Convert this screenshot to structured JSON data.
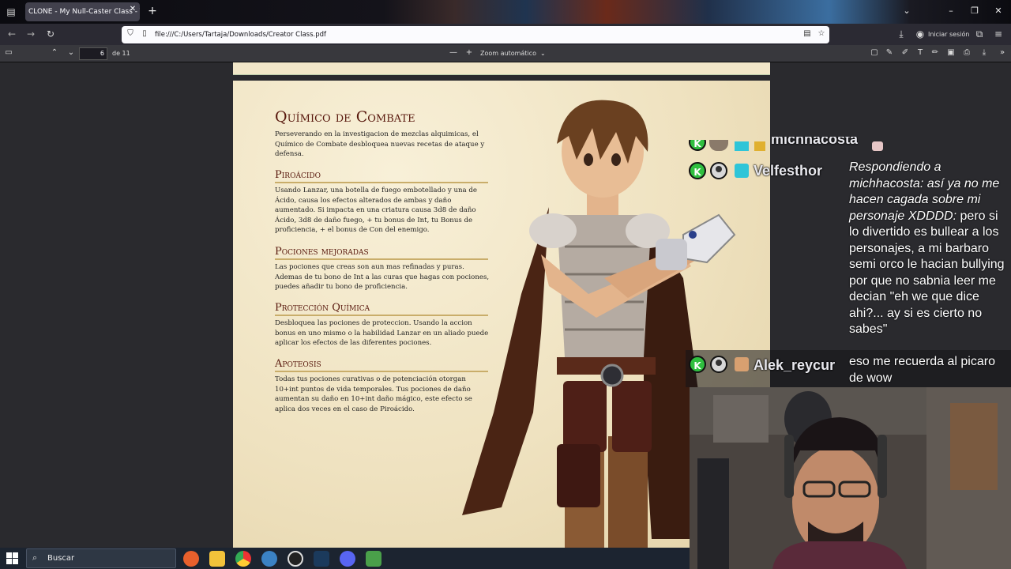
{
  "browser": {
    "tab_title": "CLONE - My Null-Caster Class - The",
    "url": "file:///C:/Users/Tartaja/Downloads/Creator Class.pdf",
    "signin_label": "Iniciar sesión",
    "icons": [
      "tab-list-icon",
      "new-tab-icon",
      "back-icon",
      "forward-icon",
      "reload-icon",
      "shield-icon",
      "page-icon",
      "reader-view-icon",
      "star-icon",
      "download-icon",
      "account-icon",
      "extensions-icon",
      "menu-icon"
    ]
  },
  "pdf_toolbar": {
    "page_number": "6",
    "page_count": "de 11",
    "zoom_minus": "—",
    "zoom_plus": "+",
    "zoom_value": "Zoom automático"
  },
  "document": {
    "title": "Químico de Combate",
    "intro": "Perseverando en la investigacion de mezclas alquimicas, el Químico de Combate desbloquea nuevas recetas de ataque y defensa.",
    "sections": [
      {
        "heading": "Piroácido",
        "text": "Usando Lanzar, una botella de fuego embotellado y una de Ácido, causa los efectos alterados de ambas y daño aumentado. Si impacta en una criatura causa 3d8 de daño Ácido, 3d8 de daño fuego, + tu bonus de Int, tu Bonus de proficiencia, + el bonus de Con del enemigo."
      },
      {
        "heading": "Pociones mejoradas",
        "text": "Las pociones que creas son aun mas refinadas y puras. Ademas de tu bono de Int a las curas que hagas con pociones, puedes añadir tu bono de proficiencia."
      },
      {
        "heading": "Protección Química",
        "text": "Desbloquea las pociones de proteccion. Usando la accion bonus en uno mismo o la habilidad Lanzar en un aliado puede aplicar los efectos de las diferentes pociones."
      },
      {
        "heading": "Apoteosis",
        "text": "Todas tus pociones curativas o de potenciación otorgan 10+int puntos de vida temporales. Tus pociones de daño aumentan su daño en 10+int daño mágico, este efecto se aplica dos veces en el caso de Piroácido."
      }
    ]
  },
  "chat": {
    "partial_user": "michhacosta",
    "messages": [
      {
        "user": "Velfesthor",
        "reply_prefix": "Respondiendo a michhacosta: así ya no me hacen cagada sobre mi personaje XDDDD:",
        "text": "pero si lo divertido es bullear a los personajes, a mi barbaro semi orco le hacian bullying por que no sabnia leer me decian \"eh we que dice ahi?... ay si es cierto no sabes\""
      },
      {
        "user": "Alek_reycur",
        "reply_prefix": "",
        "text": "eso me recuerda al picaro de wow"
      }
    ]
  },
  "taskbar": {
    "search_label": "Buscar",
    "apps": [
      "firefox-icon",
      "file-explorer-icon",
      "chrome-icon",
      "app-c-icon",
      "obs-icon",
      "steam-icon",
      "discord-icon",
      "app-grid-icon"
    ]
  },
  "colors": {
    "heading": "#58180d",
    "parchment": "#efe2c0",
    "rule": "#c9ad6a",
    "chat_badge": "#2fbf3f"
  }
}
